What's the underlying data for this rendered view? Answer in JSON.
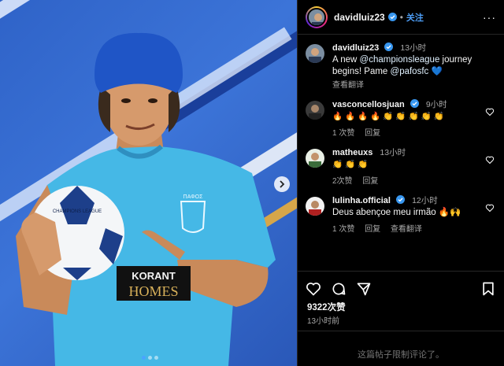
{
  "post": {
    "username": "davidluiz23",
    "follow_label": "关注",
    "separator": "•",
    "more_label": "···",
    "caption": {
      "username": "davidluiz23",
      "time": "13小时",
      "text_a": "A new ",
      "mention_1": "@championsleague",
      "text_b": " journey begins! Pame ",
      "mention_2": "@pafosfc",
      "emoji": "💙",
      "see_translation": "查看翻译"
    },
    "likes": "9322次赞",
    "posted_ago": "13小时前",
    "limited_notice": "这篇帖子限制评论了。"
  },
  "comments": [
    {
      "username": "vasconcellosjuan",
      "verified": true,
      "time": "9小时",
      "text": "🔥🔥🔥🔥👏👏👏👏👏",
      "likes": "1 次赞",
      "reply": "回复",
      "translate": ""
    },
    {
      "username": "matheuxs",
      "verified": false,
      "time": "13小时",
      "text": "👏👏👏",
      "likes": "2次赞",
      "reply": "回复",
      "translate": ""
    },
    {
      "username": "lulinha.official",
      "verified": true,
      "time": "12小时",
      "text": "Deus abençoe meu irmão 🔥🙌",
      "likes": "1 次赞",
      "reply": "回复",
      "translate": "查看翻译"
    }
  ],
  "media": {
    "shirt_sponsor_top": "KORANT",
    "shirt_sponsor_bottom": "HOMES",
    "crest_text": "ΠΑΦΟΣ",
    "ball_text": "CHAMPIONS LEAGUE"
  },
  "icons": {
    "verified": "verified-badge-icon",
    "heart": "heart-icon",
    "comment": "comment-icon",
    "share": "send-icon",
    "save": "bookmark-icon",
    "next": "chevron-right-icon"
  },
  "colors": {
    "accent": "#4d9ef7",
    "background": "#000000",
    "muted": "#a8a8a8",
    "jersey": "#45b8e6",
    "headband": "#1f55c6"
  }
}
